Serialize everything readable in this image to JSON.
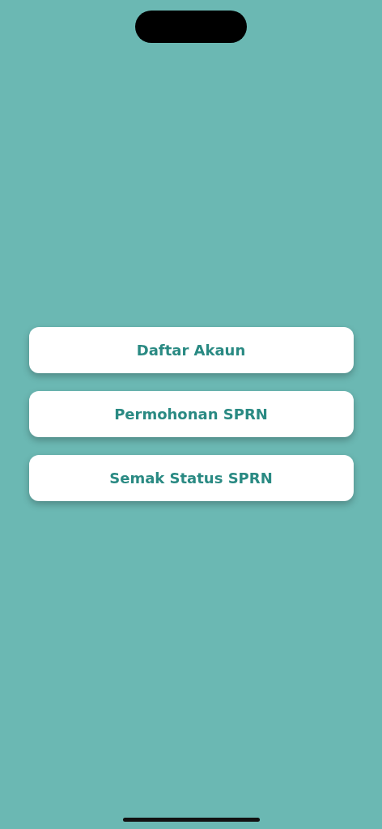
{
  "buttons": [
    {
      "label": "Daftar Akaun"
    },
    {
      "label": "Permohonan SPRN"
    },
    {
      "label": "Semak Status SPRN"
    }
  ]
}
